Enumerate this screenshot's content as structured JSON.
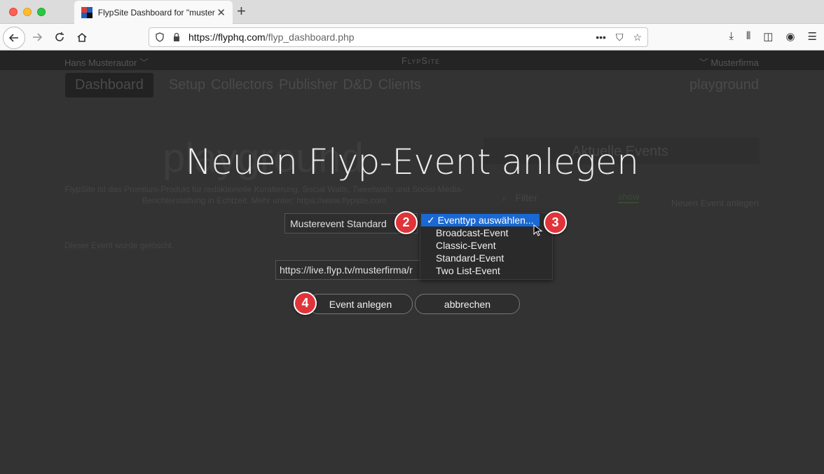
{
  "browser": {
    "tab_title": "FlypSite Dashboard for \"muster",
    "url_host": "https://flyphq.com",
    "url_path": "/flyp_dashboard.php"
  },
  "site": {
    "author": "Hans Musterautor",
    "brand": "FlypSite",
    "company": "Musterfirma",
    "menu": [
      "Dashboard",
      "Setup",
      "Collectors",
      "Publisher",
      "D&D",
      "Clients"
    ],
    "workspace": "playground",
    "heading": "playground",
    "description": "FlypSite ist das Premium-Produkt für redaktionelle Kuratierung, Social Walls, Tweetwalls und Social-Media-Berichterstattung in Echtzeit. Mehr unter: https://www.flypsite.com",
    "events_title": "Aktuelle Events",
    "filter_placeholder": "Filter",
    "show_label": "show",
    "new_event_link": "Neuen Event anlegen",
    "deleted_msg": "Dieser Event wurde gelöscht."
  },
  "modal": {
    "title": "Neuen Flyp-Event anlegen",
    "event_name": "Musterevent Standard",
    "event_url": "https://live.flyp.tv/musterfirma/r",
    "dropdown": {
      "selected": "✓ Eventtyp auswählen...",
      "options": [
        "Broadcast-Event",
        "Classic-Event",
        "Standard-Event",
        "Two List-Event"
      ]
    },
    "create_button": "Event anlegen",
    "cancel_button": "abbrechen"
  },
  "badges": {
    "b2": "2",
    "b3": "3",
    "b4": "4"
  },
  "colors": {
    "accent": "#1a68d3",
    "badge": "#e0343a",
    "backdrop": "#333333"
  }
}
